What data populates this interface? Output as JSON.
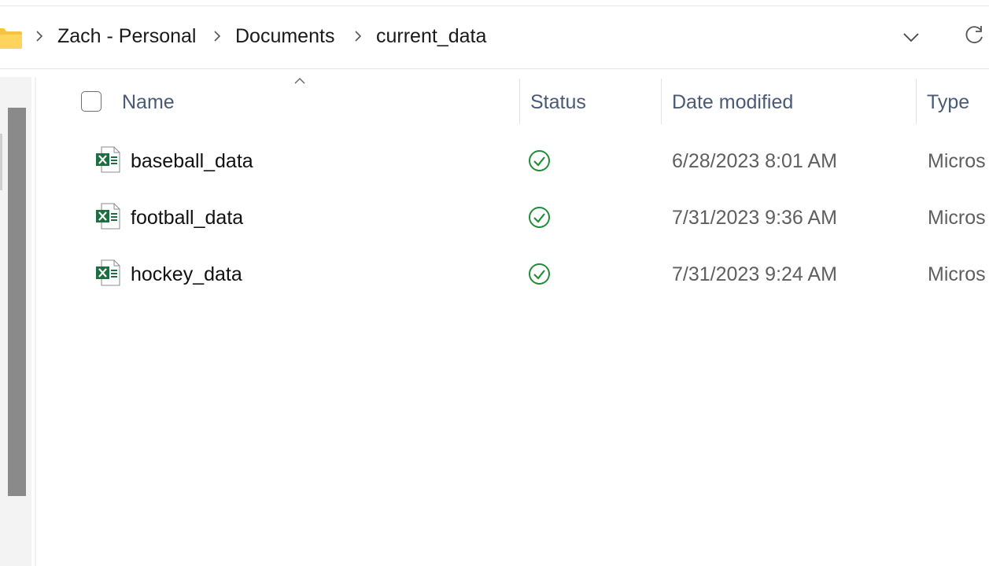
{
  "breadcrumb": {
    "items": [
      "Zach - Personal",
      "Documents",
      "current_data"
    ]
  },
  "columns": {
    "name": "Name",
    "status": "Status",
    "date_modified": "Date modified",
    "type": "Type"
  },
  "files": [
    {
      "name": "baseball_data",
      "date": "6/28/2023 8:01 AM",
      "type": "Micros",
      "status": "available",
      "icon": "excel-file-icon"
    },
    {
      "name": "football_data",
      "date": "7/31/2023 9:36 AM",
      "type": "Micros",
      "status": "available",
      "icon": "excel-file-icon"
    },
    {
      "name": "hockey_data",
      "date": "7/31/2023 9:24 AM",
      "type": "Micros",
      "status": "available",
      "icon": "excel-file-icon"
    }
  ],
  "colors": {
    "excel_green": "#1d6f42",
    "status_green": "#228b3a",
    "header_text": "#4a5a75",
    "folder_yellow": "#f5c242"
  },
  "icons": [
    "folder-icon",
    "chevron-right-icon",
    "chevron-down-icon",
    "refresh-icon",
    "sort-ascending-icon",
    "excel-file-icon",
    "synced-check-icon"
  ]
}
